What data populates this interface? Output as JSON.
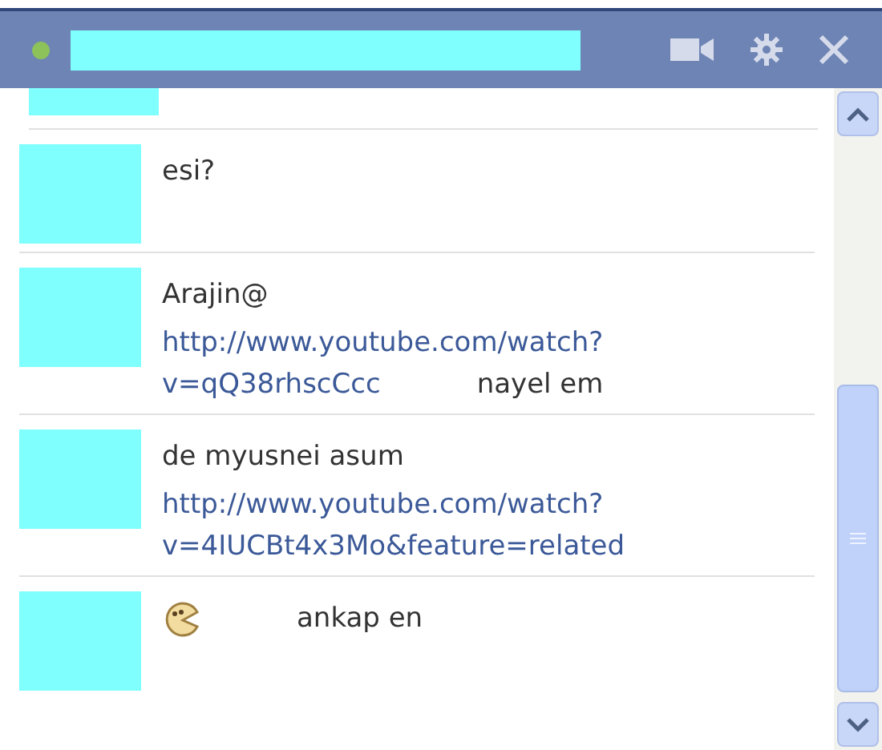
{
  "header": {
    "online": true
  },
  "messages": [
    {
      "lines": [
        [
          {
            "kind": "text",
            "text": "esi?"
          }
        ]
      ]
    },
    {
      "lines": [
        [
          {
            "kind": "text",
            "text": "Arajin@"
          }
        ],
        [
          {
            "kind": "link",
            "text": "http://www.youtube.com/watch?"
          }
        ],
        [
          {
            "kind": "link",
            "text": "v=qQ38rhscCcc"
          },
          {
            "kind": "text",
            "text": "nayel em"
          }
        ]
      ]
    },
    {
      "lines": [
        [
          {
            "kind": "text",
            "text": "de myusnei asum"
          }
        ],
        [
          {
            "kind": "link",
            "text": "http://www.youtube.com/watch?"
          }
        ],
        [
          {
            "kind": "link",
            "text": "v=4IUCBt4x3Mo&feature=related"
          }
        ]
      ]
    },
    {
      "lines": [
        [
          {
            "kind": "emoticon"
          },
          {
            "kind": "text",
            "text": "ankap en"
          }
        ]
      ]
    }
  ]
}
